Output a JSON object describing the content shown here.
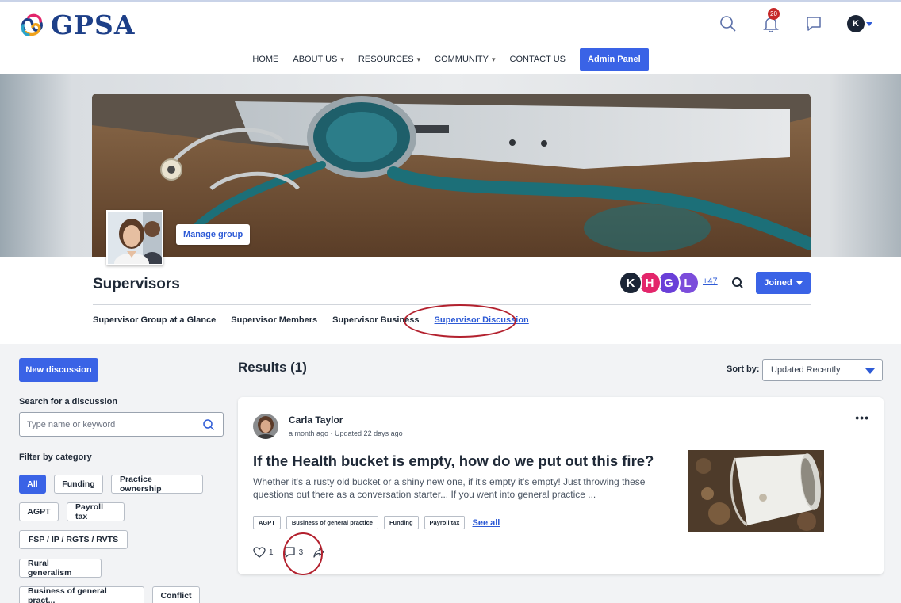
{
  "brand": {
    "name": "GPSA",
    "primary_color": "#1d3f88",
    "accent_color": "#3a63e6"
  },
  "header": {
    "notifications_count": "20",
    "user_initial": "K",
    "icons": [
      "search-icon",
      "bell-icon",
      "chat-icon",
      "user-avatar"
    ]
  },
  "nav": {
    "items": [
      {
        "label": "HOME",
        "has_dropdown": false
      },
      {
        "label": "ABOUT US",
        "has_dropdown": true
      },
      {
        "label": "RESOURCES",
        "has_dropdown": true
      },
      {
        "label": "COMMUNITY",
        "has_dropdown": true
      },
      {
        "label": "CONTACT US",
        "has_dropdown": false
      }
    ],
    "dropdown_glyph": "▾",
    "admin_label": "Admin Panel"
  },
  "group": {
    "manage_label": "Manage group",
    "title": "Supervisors",
    "members": [
      {
        "initial": "K",
        "color": "#1b2536"
      },
      {
        "initial": "H",
        "color": "#e3266b"
      },
      {
        "initial": "G",
        "color": "#6a3fd8"
      },
      {
        "initial": "L",
        "color": "#7c4ddb"
      }
    ],
    "more_members": "+47",
    "joined_label": "Joined",
    "tabs": [
      {
        "label": "Supervisor Group at a Glance",
        "active": false
      },
      {
        "label": "Supervisor Members",
        "active": false
      },
      {
        "label": "Supervisor Business",
        "active": false
      },
      {
        "label": "Supervisor Discussion",
        "active": true
      }
    ]
  },
  "sidebar": {
    "new_discussion_label": "New discussion",
    "search_label": "Search for a discussion",
    "search_placeholder": "Type name or keyword",
    "filter_label": "Filter by category",
    "categories": [
      {
        "label": "All",
        "active": true
      },
      {
        "label": "Funding",
        "active": false
      },
      {
        "label": "Practice ownership",
        "active": false
      },
      {
        "label": "AGPT",
        "active": false
      },
      {
        "label": "Payroll tax",
        "active": false
      },
      {
        "label": "FSP / IP / RGTS / RVTS",
        "active": false
      },
      {
        "label": "Rural generalism",
        "active": false
      },
      {
        "label": "Business of general pract...",
        "active": false
      },
      {
        "label": "Conflict",
        "active": false
      }
    ]
  },
  "results": {
    "title": "Results (1)",
    "sort_label": "Sort by:",
    "sort_value": "Updated Recently"
  },
  "post": {
    "author": "Carla Taylor",
    "meta": "a month ago · Updated 22 days ago",
    "more": "•••",
    "title": "If the Health bucket is empty, how do we put out this fire?",
    "excerpt": "Whether it's a rusty old bucket or a shiny new one, if it's empty it's empty! Just throwing these questions out there as a conversation starter... If you went into general practice ...",
    "tags": [
      "AGPT",
      "Business of general practice",
      "Funding",
      "Payroll tax"
    ],
    "see_all": "See all",
    "likes": "1",
    "comments": "3"
  }
}
